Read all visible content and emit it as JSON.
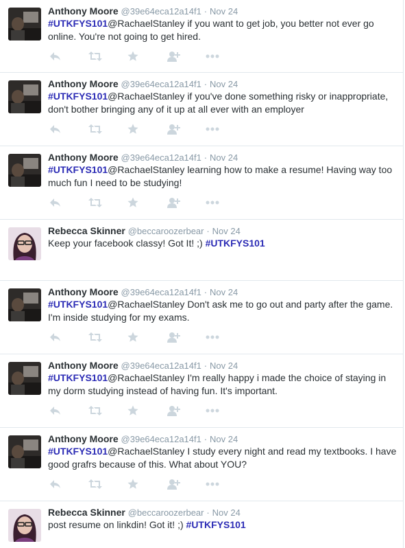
{
  "colors": {
    "name": "#292f33",
    "handle": "#8899a6",
    "hashtag": "#2b2bb5",
    "action": "#ccd6dd",
    "divider": "#e1e8ed"
  },
  "icons": [
    "reply-icon",
    "retweet-icon",
    "favorite-icon",
    "follow-icon",
    "more-icon"
  ],
  "tweets": [
    {
      "author": "Anthony Moore",
      "handle": "@39e64eca12a14f1",
      "dot": "·",
      "time": "Nov 24",
      "hashtag": "#UTKFYS101",
      "before": "",
      "after": "@RachaelStanley if you want to get job, you better not ever go online. You're not going to get hired."
    },
    {
      "author": "Anthony Moore",
      "handle": "@39e64eca12a14f1",
      "dot": "·",
      "time": "Nov 24",
      "hashtag": "#UTKFYS101",
      "before": "",
      "after": "@RachaelStanley if you've done something risky or inappropriate, don't bother bringing any of it up at all ever with an employer"
    },
    {
      "author": "Anthony Moore",
      "handle": "@39e64eca12a14f1",
      "dot": "·",
      "time": "Nov 24",
      "hashtag": "#UTKFYS101",
      "before": "",
      "after": "@RachaelStanley learning how to make a resume! Having way too much fun I need to be studying!"
    },
    {
      "author": "Rebecca Skinner",
      "handle": "@beccaroozerbear",
      "dot": "·",
      "time": "Nov 24",
      "hashtag": "#UTKFYS101",
      "before": "Keep your facebook classy! Got It! ;) ",
      "after": ""
    },
    {
      "author": "Anthony Moore",
      "handle": "@39e64eca12a14f1",
      "dot": "·",
      "time": "Nov 24",
      "hashtag": "#UTKFYS101",
      "before": "",
      "after": "@RachaelStanley Don't ask me to go out and party after the game. I'm inside studying for my exams."
    },
    {
      "author": "Anthony Moore",
      "handle": "@39e64eca12a14f1",
      "dot": "·",
      "time": "Nov 24",
      "hashtag": "#UTKFYS101",
      "before": "",
      "after": "@RachaelStanley I'm really happy i made the choice of staying in my dorm studying instead of having fun. It's important."
    },
    {
      "author": "Anthony Moore",
      "handle": "@39e64eca12a14f1",
      "dot": "·",
      "time": "Nov 24",
      "hashtag": "#UTKFYS101",
      "before": "",
      "after": "@RachaelStanley I study every night and read my textbooks. I have good grafrs because of this. What about YOU?"
    },
    {
      "author": "Rebecca Skinner",
      "handle": "@beccaroozerbear",
      "dot": "·",
      "time": "Nov 24",
      "hashtag": "#UTKFYS101",
      "before": "post resume on linkdin! Got it! ;) ",
      "after": ""
    }
  ]
}
